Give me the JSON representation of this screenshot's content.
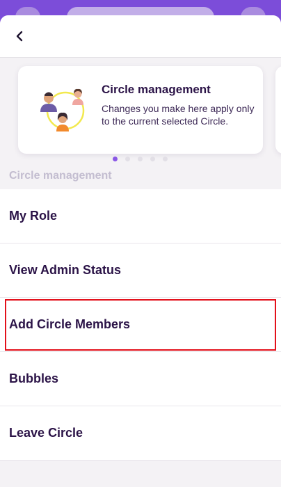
{
  "header": {
    "back_icon": "chevron-left-icon"
  },
  "carousel": {
    "card": {
      "title": "Circle management",
      "body": "Changes you make here apply only to the current selected Circle.",
      "illustration": "people-circle-icon"
    },
    "page_count": 5,
    "active_index": 0
  },
  "section": {
    "label": "Circle management"
  },
  "menu": {
    "items": [
      {
        "label": "My Role"
      },
      {
        "label": "View Admin Status"
      },
      {
        "label": "Add Circle Members",
        "highlighted": true
      },
      {
        "label": "Bubbles"
      },
      {
        "label": "Leave Circle"
      }
    ]
  },
  "colors": {
    "brand": "#7c4dd9",
    "accent_dot": "#8a57e6",
    "text_dark": "#2b1347",
    "section_label": "#c3bdd0",
    "highlight": "#e3101a"
  }
}
